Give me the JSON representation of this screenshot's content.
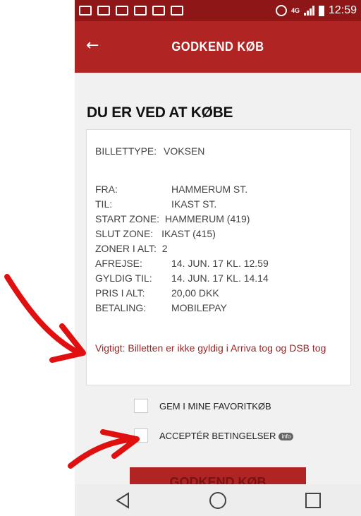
{
  "status_bar": {
    "time": "12:59",
    "network": "4G",
    "icons": [
      "notification-icon",
      "notification-icon",
      "gallery-icon",
      "gmail-icon",
      "usb-icon",
      "message-icon",
      "alarm-icon",
      "signal-icon",
      "battery-icon"
    ]
  },
  "app_bar": {
    "back_icon": "←",
    "title": "GODKEND KØB"
  },
  "page": {
    "heading": "DU ER VED AT KØBE"
  },
  "ticket": {
    "type_label": "BILLETTYPE:",
    "type_value": "VOKSEN",
    "rows": [
      {
        "label": "FRA:",
        "value": "HAMMERUM ST."
      },
      {
        "label": "TIL:",
        "value": "IKAST ST."
      },
      {
        "label": "START ZONE:",
        "value": "HAMMERUM (419)"
      },
      {
        "label": "SLUT ZONE:",
        "value": "IKAST (415)"
      },
      {
        "label": "ZONER I ALT:",
        "value": "2"
      },
      {
        "label": "AFREJSE:",
        "value": "14. JUN. 17 KL. 12.59"
      },
      {
        "label": "GYLDIG TIL:",
        "value": "14. JUN. 17 KL. 14.14"
      },
      {
        "label": "PRIS I ALT:",
        "value": "20,00 DKK"
      },
      {
        "label": "BETALING:",
        "value": "MOBILEPAY"
      }
    ],
    "warning": "Vigtigt: Billetten er ikke gyldig i Arriva tog og DSB tog"
  },
  "options": {
    "favorite_label": "GEM I MINE FAVORITKØB",
    "accept_label": "ACCEPTÉR BETINGELSER",
    "info_badge": "info"
  },
  "primary_button": {
    "label": "GODKEND KØB"
  },
  "nav_bar": {
    "icons": [
      "back-triangle-icon",
      "home-circle-icon",
      "recents-square-icon"
    ]
  },
  "annotation_color": "#e01010",
  "theme": {
    "status_bar_color": "#8f1616",
    "app_bar_color": "#b02424",
    "warning_text_color": "#9c2424"
  }
}
